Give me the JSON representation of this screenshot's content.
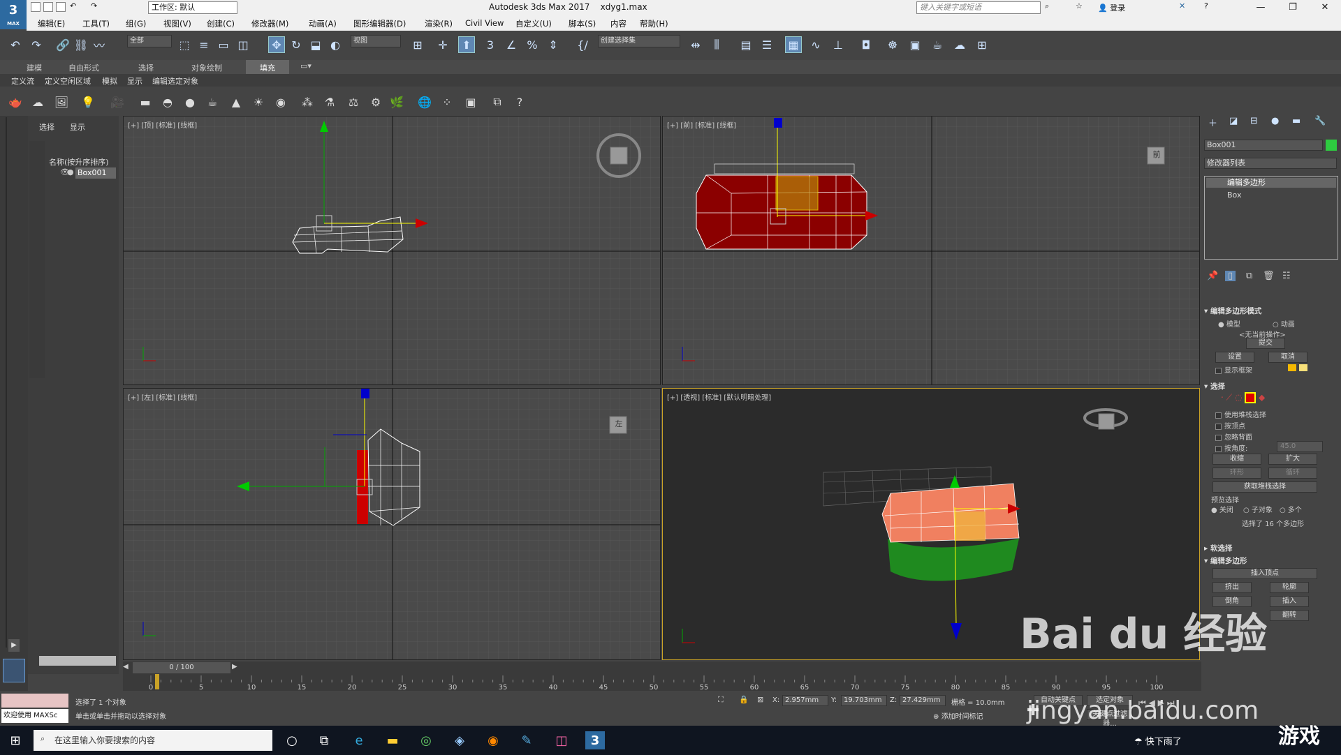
{
  "app": {
    "logo": "3",
    "logo_sub": "MAX",
    "workspace": "工作区: 默认",
    "title": "Autodesk 3ds Max 2017",
    "file": "xdyg1.max",
    "search_placeholder": "键入关键字或短语",
    "login": "登录"
  },
  "menu": [
    "编辑(E)",
    "工具(T)",
    "组(G)",
    "视图(V)",
    "创建(C)",
    "修改器(M)",
    "动画(A)",
    "图形编辑器(D)",
    "渲染(R)",
    "Civil View",
    "自定义(U)",
    "脚本(S)",
    "内容",
    "帮助(H)"
  ],
  "toolbar": {
    "filter": "全部",
    "coord": "视图",
    "selset": "创建选择集"
  },
  "ribbon": {
    "tabs": [
      "建模",
      "自由形式",
      "选择",
      "对象绘制",
      "填充"
    ],
    "active": "填充",
    "sub": [
      "定义流",
      "定义空闲区域",
      "模拟",
      "显示",
      "编辑选定对象"
    ]
  },
  "scene": {
    "tabs": [
      "选择",
      "显示"
    ],
    "header": "名称(按升序排序)",
    "item": "Box001"
  },
  "viewports": {
    "top": "[+] [顶] [标准] [线框]",
    "front": "[+] [前] [标准] [线框]",
    "left": "[+] [左] [标准] [线框]",
    "persp": "[+] [透视] [标准] [默认明暗处理]",
    "cube_front": "前",
    "cube_left": "左"
  },
  "cmd": {
    "obj": "Box001",
    "modlist": "修改器列表",
    "stack": [
      "编辑多边形",
      "Box"
    ],
    "mode_title": "编辑多边形模式",
    "model": "模型",
    "anim": "动画",
    "noop": "<无当前操作>",
    "commit": "提交",
    "settings": "设置",
    "cancel": "取消",
    "showcage": "显示框架",
    "sel_title": "选择",
    "stack_sel": "使用堆栈选择",
    "by_vertex": "按顶点",
    "ignore_back": "忽略背面",
    "by_angle": "按角度:",
    "angle": "45.0",
    "shrink": "收缩",
    "grow": "扩大",
    "ring": "环形",
    "loop": "循环",
    "get_stack": "获取堆栈选择",
    "preview": "预览选择",
    "off": "关闭",
    "subobj": "子对象",
    "multi": "多个",
    "selected": "选择了 16 个多边形",
    "soft": "软选择",
    "edit_poly": "编辑多边形",
    "insert_vertex": "插入顶点",
    "extrude": "挤出",
    "outline": "轮廓",
    "bevel": "倒角",
    "inset": "插入",
    "flip": "翻转"
  },
  "time": {
    "frame": "0 / 100",
    "ticks": [
      "0",
      "5",
      "10",
      "15",
      "20",
      "25",
      "30",
      "35",
      "40",
      "45",
      "50",
      "55",
      "60",
      "65",
      "70",
      "75",
      "80",
      "85",
      "90",
      "95",
      "100"
    ]
  },
  "status": {
    "welcome": "欢迎使用 MAXSc",
    "sel": "选择了 1 个对象",
    "hint": "单击或单击并拖动以选择对象",
    "x_label": "X:",
    "x": "2.957mm",
    "y_label": "Y:",
    "y": "19.703mm",
    "z_label": "Z:",
    "z": "27.429mm",
    "grid": "栅格 = 10.0mm",
    "addtime": "添加时间标记",
    "autokey": "自动关键点",
    "setkey": "选定对象",
    "filters": "关键点过滤器..."
  },
  "taskbar": {
    "search": "在这里输入你要搜索的内容",
    "weather": "快下雨了"
  },
  "watermark": {
    "brand": "Bai du 经验",
    "url": "jingyan.baidu.com",
    "game": "游戏"
  },
  "colors": {
    "accent": "#5f87b3",
    "red": "#8b0000",
    "salmon": "#f08060"
  }
}
